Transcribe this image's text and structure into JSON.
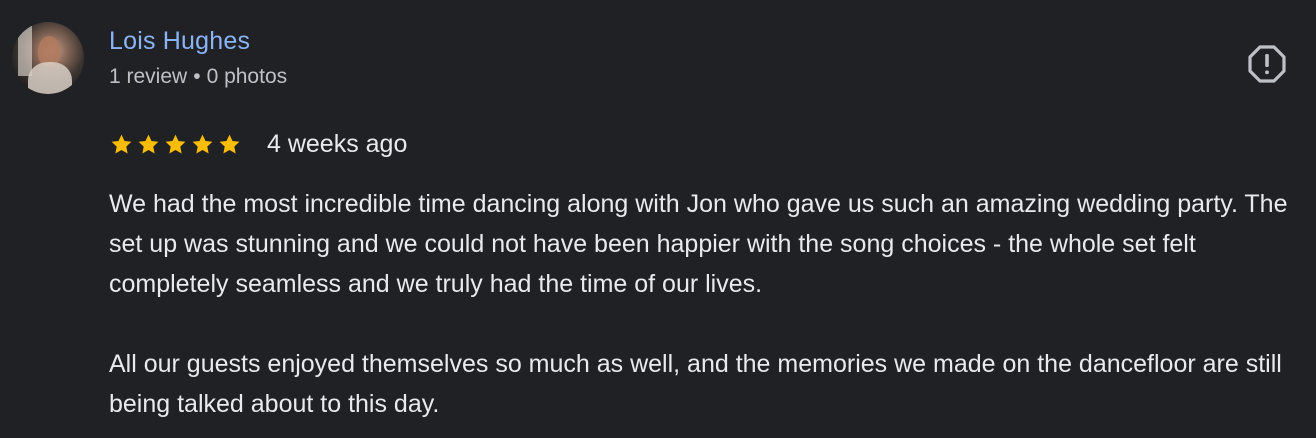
{
  "reviewer": {
    "name": "Lois Hughes",
    "review_count": "1 review",
    "separator": "•",
    "photo_count": "0 photos",
    "avatar_icon": "avatar-photo"
  },
  "report_icon": "report-flag-icon",
  "rating": {
    "stars": 5,
    "max_stars": 5,
    "star_color": "#fbbc04",
    "date": "4 weeks ago"
  },
  "review": {
    "paragraphs": [
      "We had the most incredible time dancing along with Jon who gave us such an amazing wedding party. The set up was stunning and we could not have been happier with the song choices - the whole set felt completely seamless and we truly had the time of our lives.",
      "All our guests enjoyed themselves so much as well, and the memories we made on the dancefloor are still being talked about to this day."
    ]
  },
  "colors": {
    "background": "#202124",
    "name": "#8ab4f8",
    "text": "#e8eaed",
    "muted": "#bdc1c6"
  }
}
